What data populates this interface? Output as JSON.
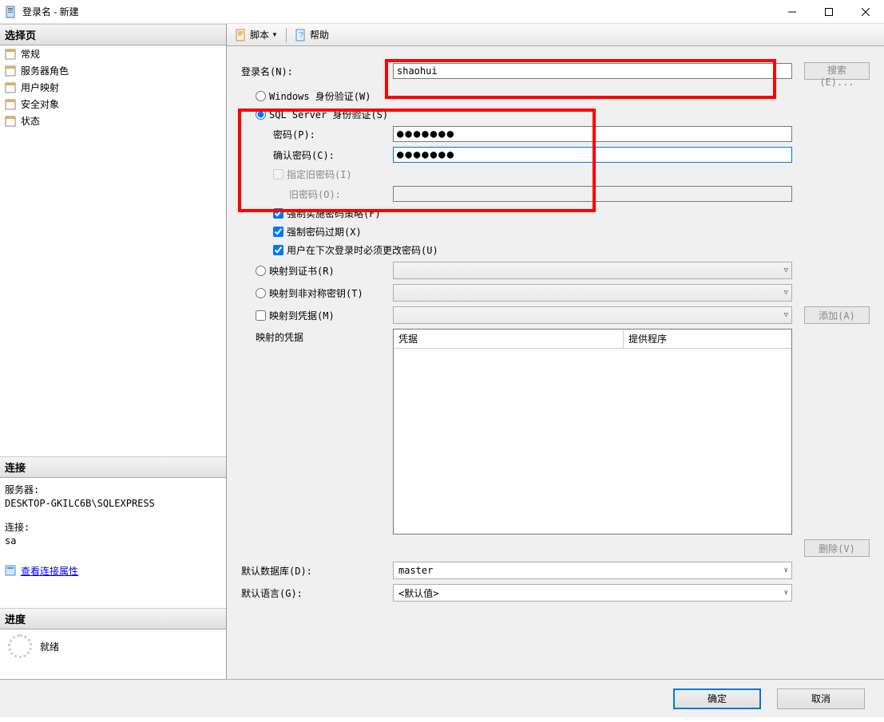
{
  "titlebar": {
    "title": "登录名 - 新建"
  },
  "sidebar": {
    "select_page_header": "选择页",
    "items": [
      {
        "label": "常规"
      },
      {
        "label": "服务器角色"
      },
      {
        "label": "用户映射"
      },
      {
        "label": "安全对象"
      },
      {
        "label": "状态"
      }
    ],
    "connection_header": "连接",
    "server_label": "服务器:",
    "server_value": "DESKTOP-GKILC6B\\SQLEXPRESS",
    "conn_label": "连接:",
    "conn_value": "sa",
    "view_conn_props": "查看连接属性",
    "progress_header": "进度",
    "progress_status": "就绪"
  },
  "toolbar": {
    "script_label": "脚本",
    "help_label": "帮助"
  },
  "form": {
    "login_name_label": "登录名(N):",
    "login_name_value": "shaohui",
    "search_btn": "搜索(E)...",
    "windows_auth_label": "Windows 身份验证(W)",
    "sql_auth_label": "SQL Server 身份验证(S)",
    "password_label": "密码(P):",
    "password_value": "●●●●●●●",
    "confirm_password_label": "确认密码(C):",
    "confirm_password_value": "●●●●●●●",
    "specify_old_label": "指定旧密码(I)",
    "old_password_label": "旧密码(O):",
    "enforce_policy_label": "强制实施密码策略(F)",
    "enforce_expiry_label": "强制密码过期(X)",
    "must_change_label": "用户在下次登录时必须更改密码(U)",
    "map_cert_label": "映射到证书(R)",
    "map_asym_label": "映射到非对称密钥(T)",
    "map_cred_label": "映射到凭据(M)",
    "add_btn": "添加(A)",
    "mapped_creds_label": "映射的凭据",
    "cred_col": "凭据",
    "provider_col": "提供程序",
    "remove_btn": "删除(V)",
    "default_db_label": "默认数据库(D):",
    "default_db_value": "master",
    "default_lang_label": "默认语言(G):",
    "default_lang_value": "<默认值>"
  },
  "buttons": {
    "ok": "确定",
    "cancel": "取消"
  }
}
